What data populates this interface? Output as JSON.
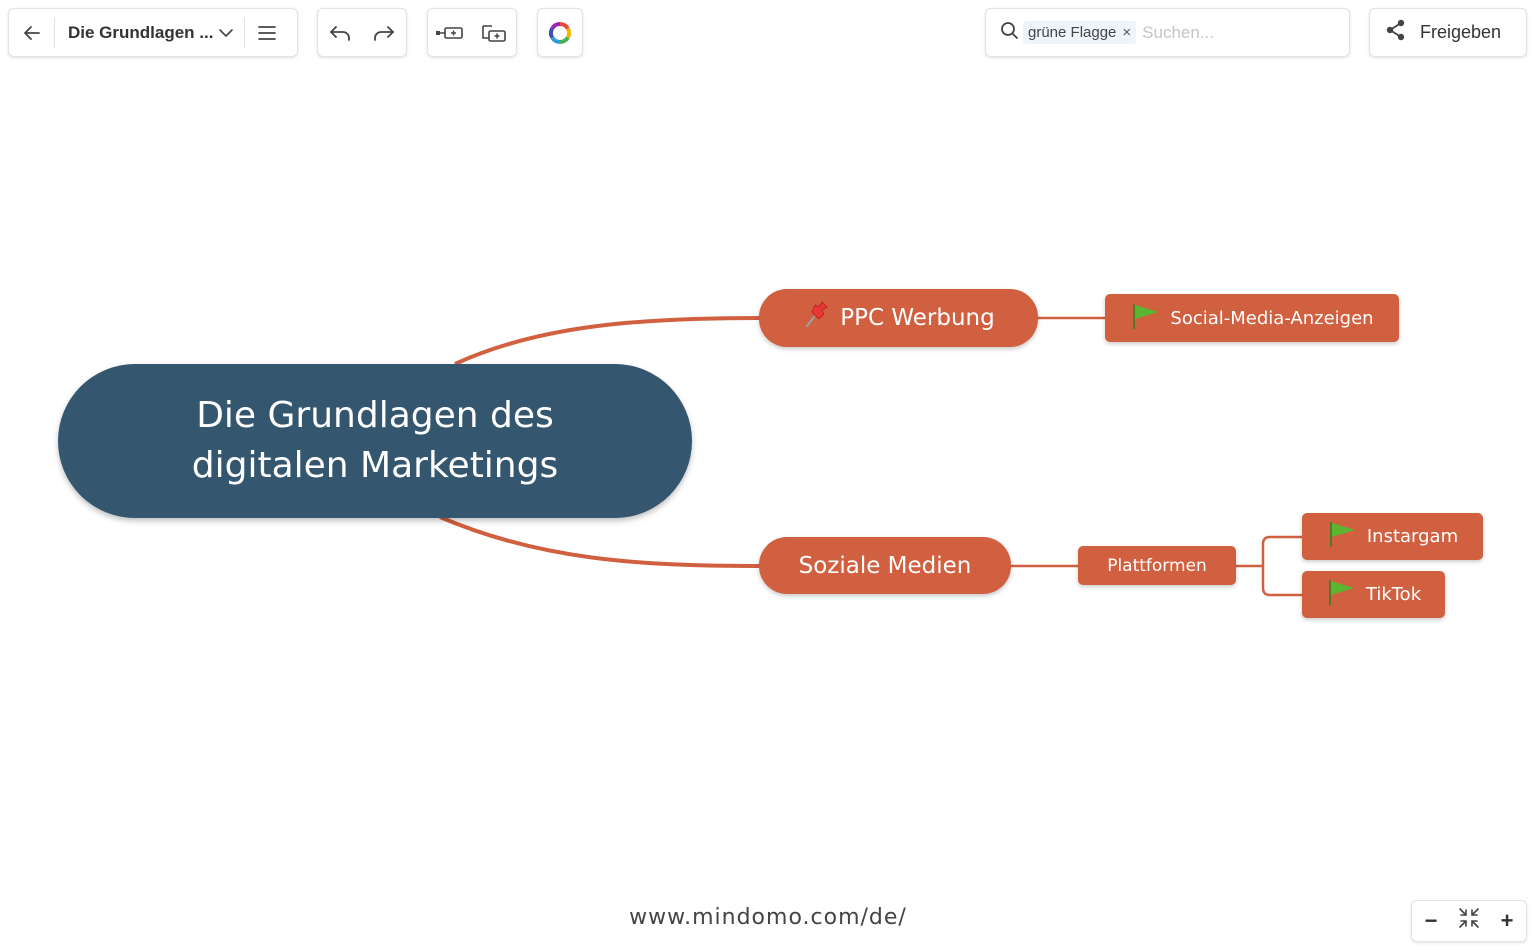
{
  "toolbar": {
    "back_icon": "arrow-left-icon",
    "document_title": "Die Grundlagen ...",
    "title_dropdown_icon": "chevron-down-icon",
    "menu_icon": "hamburger-menu-icon",
    "undo_icon": "undo-icon",
    "redo_icon": "redo-icon",
    "add_topic_icon": "add-topic-icon",
    "add_subtopic_icon": "add-subtopic-icon",
    "theme_icon": "color-wheel-icon"
  },
  "search": {
    "icon": "search-icon",
    "filter_chip": "grüne Flagge",
    "chip_remove": "×",
    "placeholder": "Suchen..."
  },
  "share": {
    "icon": "share-icon",
    "label": "Freigeben"
  },
  "mindmap": {
    "central_topic": {
      "line1": "Die Grundlagen des",
      "line2": "digitalen Marketings"
    },
    "branches": [
      {
        "label": "PPC Werbung",
        "icon": "pushpin-icon",
        "children": [
          {
            "label": "Social-Media-Anzeigen",
            "icon": "green-flag-icon"
          }
        ]
      },
      {
        "label": "Soziale Medien",
        "children": [
          {
            "label": "Plattformen",
            "children": [
              {
                "label": "Instargam",
                "icon": "green-flag-icon"
              },
              {
                "label": "TikTok",
                "icon": "green-flag-icon"
              }
            ]
          }
        ]
      }
    ]
  },
  "watermark": "www.mindomo.com/de/",
  "zoom": {
    "out_label": "−",
    "fit_icon": "fit-to-screen-icon",
    "in_label": "+"
  },
  "colors": {
    "central_node": "#34566f",
    "branch_node": "#d0603f",
    "connector": "#d0603f",
    "flag_green": "#5cb531"
  }
}
